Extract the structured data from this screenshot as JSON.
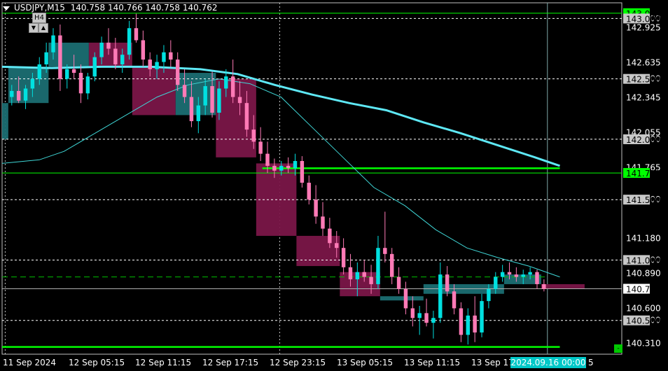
{
  "title": {
    "symbol": "USDJPY,M15",
    "ohlc": "140.758 140.766 140.758 140.762"
  },
  "timeframe_widget": {
    "label": "H4",
    "down_icon": "triangle-down-icon",
    "up_icon": "triangle-up-icon"
  },
  "chart_data": {
    "type": "candlestick",
    "symbol": "USDJPY",
    "timeframe": "M15",
    "ylim": [
      140.22,
      143.13
    ],
    "price_ticks": [
      "143.000",
      "142.925",
      "142.635",
      "142.500",
      "142.345",
      "142.055",
      "142.000",
      "141.765",
      "141.500",
      "141.180",
      "141.000",
      "140.890",
      "140.600",
      "140.500",
      "140.310"
    ],
    "time_ticks": [
      "11 Sep 2024",
      "12 Sep 05:15",
      "12 Sep 11:15",
      "12 Sep 17:15",
      "12 Sep 23:15",
      "13 Sep 05:15",
      "13 Sep 11:15",
      "13 Sep 17"
    ],
    "time_tick_fragment": "5",
    "crosshair_time_label": "2024.09.16 00:00",
    "current_price": "140.762",
    "level_lines": [
      {
        "price": 143.044,
        "label": "143.044",
        "color": "#00ff00"
      },
      {
        "price": 141.721,
        "label": "141.721",
        "color": "#00ff00"
      },
      {
        "price": 142.5,
        "label": "142.500",
        "color": "#ffffff"
      },
      {
        "price": 142.0,
        "label": "142.000",
        "color": "#ffffff"
      },
      {
        "price": 141.5,
        "label": "141.500",
        "color": "#ffffff"
      },
      {
        "price": 141.0,
        "label": "141.000",
        "color": "#ffffff"
      },
      {
        "price": 140.5,
        "label": "140.500",
        "color": "#ffffff"
      },
      {
        "price": 143.0,
        "label": "143.000",
        "color": "#ffffff"
      }
    ],
    "green_segments": [
      {
        "start": 0.42,
        "end": 0.9,
        "price": 141.76
      },
      {
        "start": 0.0,
        "end": 0.9,
        "price": 140.28
      }
    ],
    "dashed_green_price": 140.86,
    "h4_boxes": [
      {
        "start": 0.0,
        "end": 0.01,
        "open": 142.0,
        "close": 142.3,
        "dir": "up"
      },
      {
        "start": 0.01,
        "end": 0.075,
        "open": 142.3,
        "close": 142.6,
        "dir": "up"
      },
      {
        "start": 0.075,
        "end": 0.14,
        "open": 142.6,
        "close": 142.8,
        "dir": "up"
      },
      {
        "start": 0.14,
        "end": 0.21,
        "open": 142.8,
        "close": 142.6,
        "dir": "down"
      },
      {
        "start": 0.21,
        "end": 0.28,
        "open": 142.6,
        "close": 142.2,
        "dir": "down"
      },
      {
        "start": 0.28,
        "end": 0.345,
        "open": 142.2,
        "close": 142.55,
        "dir": "up"
      },
      {
        "start": 0.345,
        "end": 0.41,
        "open": 142.5,
        "close": 141.85,
        "dir": "down"
      },
      {
        "start": 0.41,
        "end": 0.475,
        "open": 141.8,
        "close": 141.2,
        "dir": "down"
      },
      {
        "start": 0.475,
        "end": 0.545,
        "open": 141.2,
        "close": 140.95,
        "dir": "down"
      },
      {
        "start": 0.545,
        "end": 0.61,
        "open": 140.9,
        "close": 140.7,
        "dir": "down"
      },
      {
        "start": 0.61,
        "end": 0.68,
        "open": 140.7,
        "close": 140.7,
        "dir": "up"
      },
      {
        "start": 0.68,
        "end": 0.81,
        "open": 140.72,
        "close": 140.8,
        "dir": "up"
      },
      {
        "start": 0.81,
        "end": 0.87,
        "open": 140.8,
        "close": 140.88,
        "dir": "up"
      },
      {
        "start": 0.87,
        "end": 0.94,
        "open": 140.8,
        "close": 140.76,
        "dir": "down"
      }
    ],
    "slow_ma": [
      [
        0.0,
        142.6
      ],
      [
        0.08,
        142.59
      ],
      [
        0.16,
        142.6
      ],
      [
        0.24,
        142.6
      ],
      [
        0.32,
        142.58
      ],
      [
        0.38,
        142.54
      ],
      [
        0.44,
        142.45
      ],
      [
        0.5,
        142.37
      ],
      [
        0.56,
        142.3
      ],
      [
        0.62,
        142.24
      ],
      [
        0.68,
        142.14
      ],
      [
        0.74,
        142.05
      ],
      [
        0.8,
        141.95
      ],
      [
        0.86,
        141.85
      ],
      [
        0.9,
        141.78
      ]
    ],
    "mid_ma": [
      [
        0.0,
        141.8
      ],
      [
        0.06,
        141.83
      ],
      [
        0.1,
        141.9
      ],
      [
        0.15,
        142.05
      ],
      [
        0.2,
        142.2
      ],
      [
        0.25,
        142.35
      ],
      [
        0.3,
        142.45
      ],
      [
        0.35,
        142.5
      ],
      [
        0.4,
        142.46
      ],
      [
        0.45,
        142.35
      ],
      [
        0.5,
        142.1
      ],
      [
        0.55,
        141.85
      ],
      [
        0.6,
        141.6
      ],
      [
        0.65,
        141.45
      ],
      [
        0.7,
        141.25
      ],
      [
        0.75,
        141.1
      ],
      [
        0.8,
        141.02
      ],
      [
        0.85,
        140.95
      ],
      [
        0.9,
        140.86
      ]
    ],
    "candles": [
      [
        142.35,
        142.45,
        142.28,
        142.4
      ],
      [
        142.4,
        142.52,
        142.3,
        142.32
      ],
      [
        142.32,
        142.45,
        142.25,
        142.42
      ],
      [
        142.42,
        142.55,
        142.35,
        142.5
      ],
      [
        142.5,
        142.68,
        142.45,
        142.62
      ],
      [
        142.62,
        142.8,
        142.55,
        142.72
      ],
      [
        142.72,
        142.92,
        142.66,
        142.86
      ],
      [
        142.86,
        142.95,
        142.4,
        142.5
      ],
      [
        142.5,
        142.62,
        142.42,
        142.58
      ],
      [
        142.58,
        142.7,
        142.5,
        142.55
      ],
      [
        142.55,
        142.62,
        142.3,
        142.38
      ],
      [
        142.38,
        142.55,
        142.33,
        142.52
      ],
      [
        142.52,
        142.72,
        142.48,
        142.68
      ],
      [
        142.68,
        142.85,
        142.62,
        142.8
      ],
      [
        142.8,
        142.92,
        142.7,
        142.75
      ],
      [
        142.75,
        142.84,
        142.58,
        142.62
      ],
      [
        142.62,
        142.75,
        142.55,
        142.7
      ],
      [
        142.7,
        142.98,
        142.66,
        142.92
      ],
      [
        142.92,
        143.04,
        142.8,
        142.82
      ],
      [
        142.82,
        142.9,
        142.6,
        142.66
      ],
      [
        142.66,
        142.72,
        142.52,
        142.58
      ],
      [
        142.58,
        142.7,
        142.5,
        142.64
      ],
      [
        142.64,
        142.78,
        142.55,
        142.72
      ],
      [
        142.72,
        142.82,
        142.6,
        142.66
      ],
      [
        142.66,
        142.72,
        142.4,
        142.45
      ],
      [
        142.45,
        142.58,
        142.3,
        142.35
      ],
      [
        142.35,
        142.48,
        142.1,
        142.15
      ],
      [
        142.15,
        142.35,
        142.05,
        142.28
      ],
      [
        142.28,
        142.5,
        142.2,
        142.44
      ],
      [
        142.44,
        142.56,
        142.18,
        142.22
      ],
      [
        142.22,
        142.48,
        142.16,
        142.42
      ],
      [
        142.42,
        142.58,
        142.35,
        142.52
      ],
      [
        142.52,
        142.66,
        142.3,
        142.35
      ],
      [
        142.35,
        142.48,
        142.2,
        142.3
      ],
      [
        142.3,
        142.4,
        142.02,
        142.08
      ],
      [
        142.08,
        142.2,
        141.92,
        141.98
      ],
      [
        141.98,
        142.1,
        141.82,
        141.88
      ],
      [
        141.88,
        141.98,
        141.72,
        141.78
      ],
      [
        141.78,
        141.84,
        141.68,
        141.74
      ],
      [
        141.74,
        141.82,
        141.7,
        141.78
      ],
      [
        141.78,
        141.85,
        141.72,
        141.76
      ],
      [
        141.76,
        141.88,
        141.7,
        141.82
      ],
      [
        141.82,
        141.86,
        141.6,
        141.64
      ],
      [
        141.64,
        141.7,
        141.46,
        141.5
      ],
      [
        141.5,
        141.62,
        141.3,
        141.36
      ],
      [
        141.36,
        141.48,
        141.2,
        141.26
      ],
      [
        141.26,
        141.35,
        141.1,
        141.14
      ],
      [
        141.14,
        141.24,
        141.02,
        141.1
      ],
      [
        141.1,
        141.18,
        140.88,
        140.94
      ],
      [
        140.94,
        141.05,
        140.78,
        140.84
      ],
      [
        140.84,
        140.98,
        140.7,
        140.9
      ],
      [
        140.9,
        141.0,
        140.82,
        140.86
      ],
      [
        140.86,
        140.96,
        140.72,
        140.8
      ],
      [
        140.8,
        141.2,
        140.76,
        141.1
      ],
      [
        141.1,
        141.4,
        140.98,
        141.05
      ],
      [
        141.05,
        141.1,
        140.8,
        140.86
      ],
      [
        140.86,
        140.94,
        140.72,
        140.76
      ],
      [
        140.76,
        140.82,
        140.55,
        140.6
      ],
      [
        140.6,
        140.7,
        140.45,
        140.52
      ],
      [
        140.52,
        140.62,
        140.38,
        140.56
      ],
      [
        140.56,
        140.68,
        140.45,
        140.48
      ],
      [
        140.48,
        140.58,
        140.35,
        140.52
      ],
      [
        140.52,
        140.98,
        140.48,
        140.88
      ],
      [
        140.88,
        140.95,
        140.7,
        140.74
      ],
      [
        140.74,
        140.8,
        140.55,
        140.6
      ],
      [
        140.6,
        140.65,
        140.32,
        140.38
      ],
      [
        140.38,
        140.6,
        140.3,
        140.54
      ],
      [
        140.54,
        140.7,
        140.32,
        140.4
      ],
      [
        140.4,
        140.72,
        140.36,
        140.66
      ],
      [
        140.66,
        140.8,
        140.6,
        140.76
      ],
      [
        140.76,
        140.9,
        140.72,
        140.86
      ],
      [
        140.86,
        140.96,
        140.82,
        140.9
      ],
      [
        140.9,
        140.98,
        140.84,
        140.88
      ],
      [
        140.88,
        140.94,
        140.82,
        140.86
      ],
      [
        140.86,
        140.92,
        140.8,
        140.88
      ],
      [
        140.88,
        140.94,
        140.84,
        140.9
      ],
      [
        140.9,
        140.92,
        140.76,
        140.8
      ],
      [
        140.8,
        140.84,
        140.74,
        140.76
      ]
    ]
  }
}
